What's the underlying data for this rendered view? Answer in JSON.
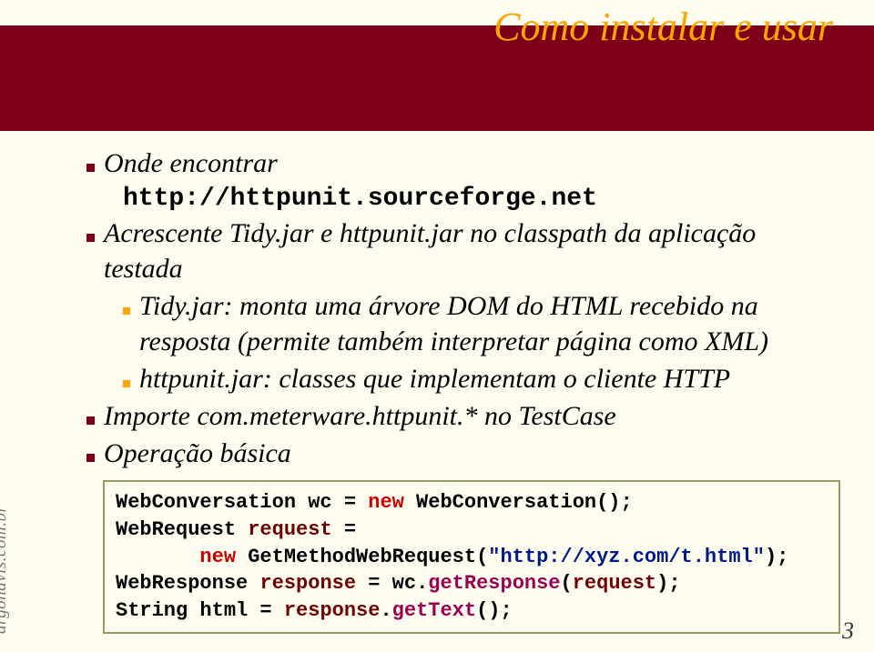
{
  "title": "Como instalar e usar",
  "b1": "Onde encontrar",
  "b1a": "http://httpunit.sourceforge.net",
  "b2": "Acrescente Tidy.jar e httpunit.jar no classpath da aplicação testada",
  "b2s1": "Tidy.jar: monta uma árvore DOM do HTML recebido na resposta (permite também interpretar página como XML)",
  "b2s2": "httpunit.jar: classes que implementam o cliente HTTP",
  "b3": "Importe com.meterware.httpunit.* no TestCase",
  "b4": "Operação básica",
  "code": {
    "l1a": "WebConversation wc = ",
    "l1b": "new",
    "l1c": " WebConversation();",
    "l2a": "WebRequest ",
    "l2b": "request",
    "l2c": " =",
    "l3a": "       ",
    "l3b": "new",
    "l3c": " GetMethodWebRequest(",
    "l3d": "\"http://xyz.com/t.html\"",
    "l3e": ");",
    "l4a": "WebResponse ",
    "l4b": "response",
    "l4c": " = wc.",
    "l4d": "getResponse",
    "l4e": "(",
    "l4f": "request",
    "l4g": ");",
    "l5a": "String html = ",
    "l5b": "response",
    "l5c": ".",
    "l5d": "getText",
    "l5e": "();"
  },
  "sidebar": "argonavis.com.br",
  "pagenum": "3"
}
